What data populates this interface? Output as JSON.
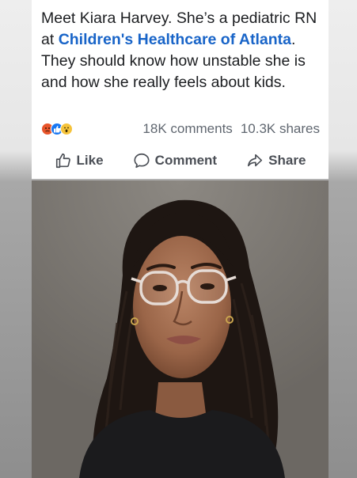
{
  "post": {
    "text_parts": {
      "before": "Meet Kiara Harvey. She’s a pediatric RN at ",
      "link": "Children's Healthcare of Atlanta",
      "after": ". They should know how unstable she is and how she really feels about kids."
    },
    "reactions": [
      "angry-react-icon",
      "like-react-icon",
      "wow-react-icon"
    ],
    "comments": "18K comments",
    "shares": "10.3K shares",
    "actions": {
      "like": "Like",
      "comment": "Comment",
      "share": "Share"
    }
  },
  "colors": {
    "link": "#1864c8",
    "angry": "#e8552b",
    "like": "#1877f2",
    "wow": "#f5c33b"
  }
}
